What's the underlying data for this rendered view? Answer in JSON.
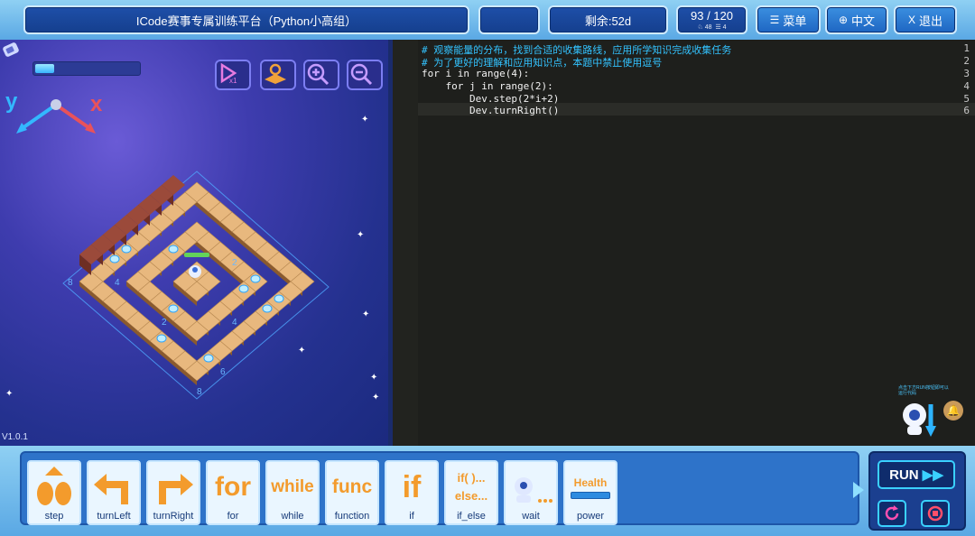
{
  "header": {
    "title": "ICode赛事专属训练平台（Python小高组）",
    "remaining": "剩余:52d",
    "progress": "93 / 120",
    "stats_a": "♘ 48",
    "stats_b": "☰ 4",
    "menu_label": "菜单",
    "language_label": "中文",
    "exit_label": "退出"
  },
  "game": {
    "version": "V1.0.1",
    "axis_y": "y",
    "axis_x": "x",
    "energy_fraction": 0.18,
    "tile_labels": [
      "8",
      "4",
      "2",
      "2",
      "4",
      "6",
      "8"
    ]
  },
  "editor": {
    "line_numbers": [
      "1",
      "2",
      "3",
      "4",
      "5",
      "6"
    ],
    "lines": [
      "# 观察能量的分布，找到合适的收集路线，应用所学知识完成收集任务",
      "# 为了更好的理解和应用知识点，本题中禁止使用逗号",
      "for i in range(4):",
      "    for j in range(2):",
      "        Dev.step(2*i+2)",
      "        Dev.turnRight()"
    ],
    "hint": "点击下方RUN按钮即可以运行代码"
  },
  "blocks": [
    {
      "label": "step",
      "icon": "step-icon"
    },
    {
      "label": "turnLeft",
      "icon": "turn-left-icon"
    },
    {
      "label": "turnRight",
      "icon": "turn-right-icon"
    },
    {
      "label": "for",
      "icon": "for-icon",
      "art": "for"
    },
    {
      "label": "while",
      "icon": "while-icon",
      "art": "while"
    },
    {
      "label": "function",
      "icon": "func-icon",
      "art": "func"
    },
    {
      "label": "if",
      "icon": "if-icon",
      "art": "if"
    },
    {
      "label": "if_else",
      "icon": "if-else-icon",
      "art": "if( )...\nelse..."
    },
    {
      "label": "wait",
      "icon": "wait-icon"
    },
    {
      "label": "power",
      "icon": "power-icon",
      "art": "Health"
    }
  ],
  "run": {
    "label": "RUN"
  }
}
